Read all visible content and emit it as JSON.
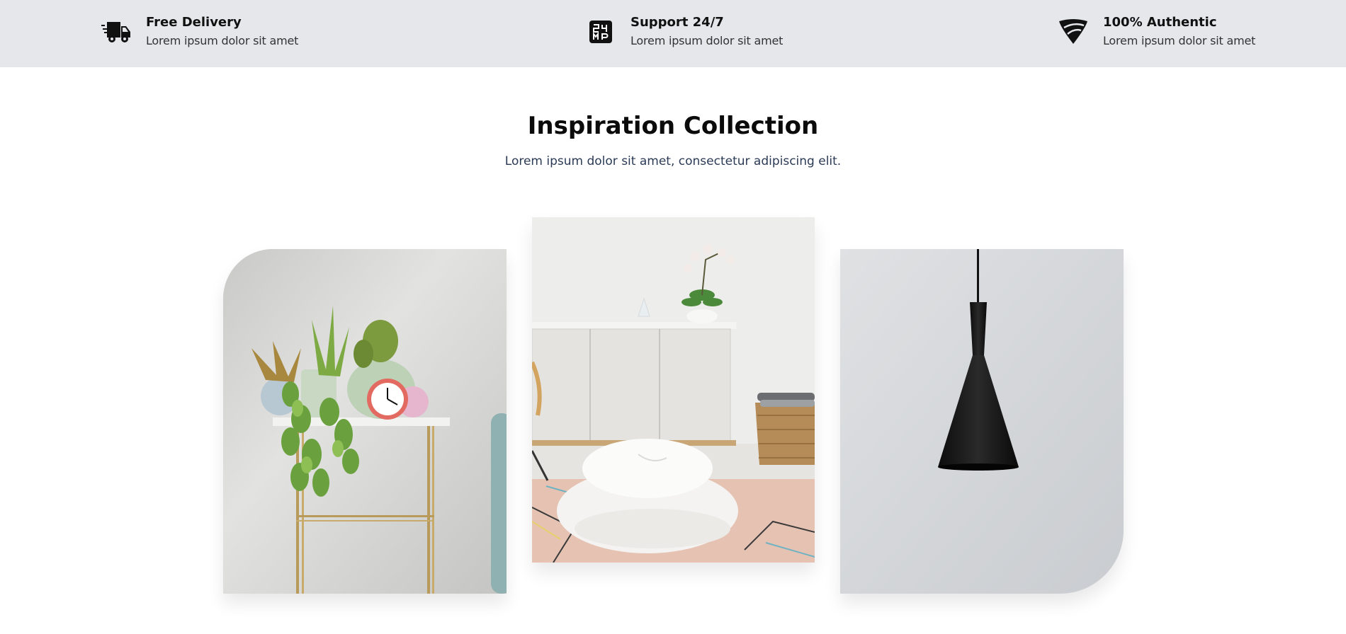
{
  "features": [
    {
      "icon": "delivery-truck-icon",
      "title": "Free Delivery",
      "desc": "Lorem ipsum dolor sit amet"
    },
    {
      "icon": "support-24-7-icon",
      "title": "Support 24/7",
      "desc": "Lorem ipsum dolor sit amet"
    },
    {
      "icon": "shield-icon",
      "title": "100% Authentic",
      "desc": "Lorem ipsum dolor sit amet"
    }
  ],
  "collection": {
    "title": "Inspiration Collection",
    "subtitle": "Lorem ipsum dolor sit amet, consectetur adipiscing elit."
  },
  "colors": {
    "feature_bar_bg": "#e5e7eb",
    "heading": "#0b0b0b",
    "subheading": "#2b3a55"
  }
}
